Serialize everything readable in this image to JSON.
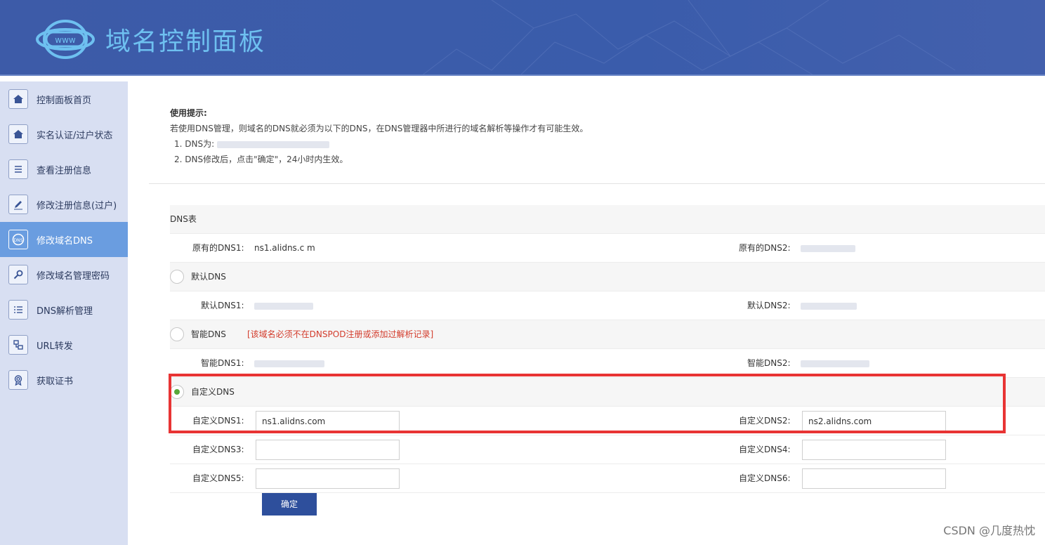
{
  "header": {
    "title": "域名控制面板",
    "logo_text": "www"
  },
  "sidebar": {
    "items": [
      {
        "label": "控制面板首页",
        "icon": "home-icon",
        "active": false
      },
      {
        "label": "实名认证/过户状态",
        "icon": "home-icon",
        "active": false
      },
      {
        "label": "查看注册信息",
        "icon": "document-icon",
        "active": false
      },
      {
        "label": "修改注册信息(过户)",
        "icon": "edit-icon",
        "active": false
      },
      {
        "label": "修改域名DNS",
        "icon": "dns-icon",
        "active": true
      },
      {
        "label": "修改域名管理密码",
        "icon": "key-icon",
        "active": false
      },
      {
        "label": "DNS解析管理",
        "icon": "list-icon",
        "active": false
      },
      {
        "label": "URL转发",
        "icon": "forward-icon",
        "active": false
      },
      {
        "label": "获取证书",
        "icon": "certificate-icon",
        "active": false
      }
    ]
  },
  "tips": {
    "title": "使用提示:",
    "line": "若使用DNS管理，则域名的DNS就必须为以下的DNS，在DNS管理器中所进行的域名解析等操作才有可能生效。",
    "step1": "1. DNS为:",
    "step2": "2. DNS修改后，点击\"确定\"，24小时内生效。"
  },
  "dns_table": {
    "caption": "DNS表",
    "original": {
      "label1": "原有的DNS1:",
      "value1": "ns1.alidns.c  m",
      "label2": "原有的DNS2:",
      "value2": ""
    },
    "default_option": {
      "label": "默认DNS",
      "selected": false
    },
    "default": {
      "label1": "默认DNS1:",
      "value1": "",
      "label2": "默认DNS2:",
      "value2": ""
    },
    "smart_option": {
      "label": "智能DNS",
      "selected": false,
      "warning": "[该域名必须不在DNSPOD注册或添加过解析记录]"
    },
    "smart": {
      "label1": "智能DNS1:",
      "value1": "",
      "label2": "智能DNS2:",
      "value2": ""
    },
    "custom_option": {
      "label": "自定义DNS",
      "selected": true
    },
    "custom": [
      {
        "label1": "自定义DNS1:",
        "value1": "ns1.alidns.com",
        "label2": "自定义DNS2:",
        "value2": "ns2.alidns.com"
      },
      {
        "label1": "自定义DNS3:",
        "value1": "",
        "label2": "自定义DNS4:",
        "value2": ""
      },
      {
        "label1": "自定义DNS5:",
        "value1": "",
        "label2": "自定义DNS6:",
        "value2": ""
      }
    ],
    "submit_label": "确定"
  },
  "watermark": "CSDN @几度热忱",
  "colors": {
    "header": "#3d5ba8",
    "sidebar": "#d8dff2",
    "active": "#6a9de0",
    "highlight_box": "#e83434",
    "button": "#2e4f9c"
  }
}
